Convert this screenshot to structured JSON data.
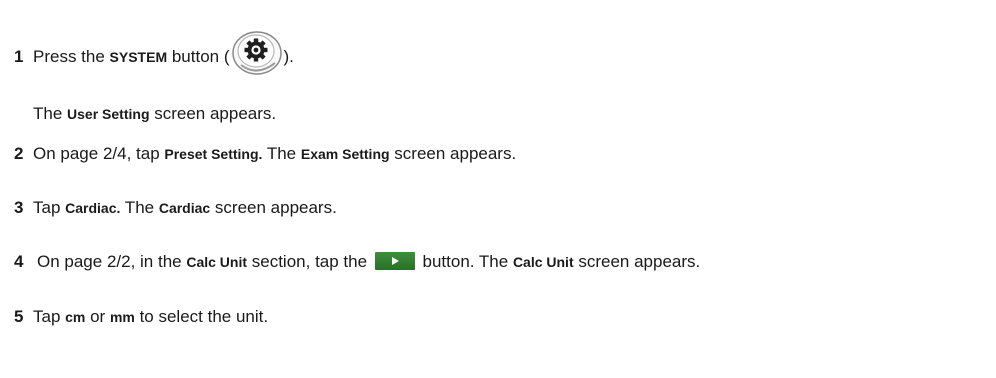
{
  "steps": [
    {
      "number": "1",
      "text_a": "Press the ",
      "bold_a": "SYSTEM",
      "text_b": " button (",
      "icon": "system-gear-icon",
      "text_c": ")."
    },
    {
      "result": {
        "text_a": "The ",
        "bold_a": "User Setting",
        "text_b": " screen appears."
      }
    },
    {
      "number": "2",
      "text_a": "On page 2/4, tap ",
      "bold_a": "Preset Setting.",
      "text_b": " The ",
      "bold_b": "Exam Setting",
      "text_c": " screen appears."
    },
    {
      "number": "3",
      "text_a": "Tap ",
      "bold_a": "Cardiac.",
      "text_b": " The ",
      "bold_b": "Cardiac",
      "text_c": " screen appears."
    },
    {
      "number": "4",
      "text_a": "On page 2/2, in the ",
      "bold_a": "Calc Unit",
      "text_b": " section, tap the ",
      "icon": "play-button-icon",
      "text_c": " button. The ",
      "bold_b": "Calc Unit",
      "text_d": " screen appears."
    },
    {
      "number": "5",
      "text_a": "Tap ",
      "bold_a": "cm",
      "text_b": " or ",
      "bold_b": "mm",
      "text_c": " to select the unit."
    }
  ],
  "colors": {
    "text": "#1a1a1a",
    "play_button": "#2f7d32"
  }
}
